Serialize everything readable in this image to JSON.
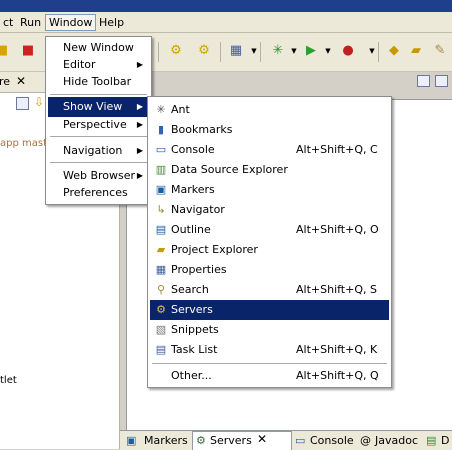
{
  "menubar": {
    "items": [
      "ct",
      "Run",
      "Window",
      "Help"
    ]
  },
  "window_menu": {
    "items": [
      {
        "label": "New Window",
        "submenu": false
      },
      {
        "label": "Editor",
        "submenu": true
      },
      {
        "label": "Hide Toolbar",
        "submenu": false
      },
      {
        "label": "Show View",
        "submenu": true,
        "selected": true
      },
      {
        "label": "Perspective",
        "submenu": true
      },
      {
        "label": "Navigation",
        "submenu": true
      },
      {
        "label": "Web Browser",
        "submenu": true
      },
      {
        "label": "Preferences",
        "submenu": false
      }
    ]
  },
  "show_view_menu": {
    "items": [
      {
        "label": "Ant",
        "shortcut": "",
        "icon": "ant-icon"
      },
      {
        "label": "Bookmarks",
        "shortcut": "",
        "icon": "bookmarks-icon"
      },
      {
        "label": "Console",
        "shortcut": "Alt+Shift+Q, C",
        "icon": "console-icon"
      },
      {
        "label": "Data Source Explorer",
        "shortcut": "",
        "icon": "data-source-icon"
      },
      {
        "label": "Markers",
        "shortcut": "",
        "icon": "markers-icon"
      },
      {
        "label": "Navigator",
        "shortcut": "",
        "icon": "navigator-icon"
      },
      {
        "label": "Outline",
        "shortcut": "Alt+Shift+Q, O",
        "icon": "outline-icon"
      },
      {
        "label": "Project Explorer",
        "shortcut": "",
        "icon": "project-explorer-icon"
      },
      {
        "label": "Properties",
        "shortcut": "",
        "icon": "properties-icon"
      },
      {
        "label": "Search",
        "shortcut": "Alt+Shift+Q, S",
        "icon": "search-icon"
      },
      {
        "label": "Servers",
        "shortcut": "",
        "icon": "servers-icon",
        "selected": true
      },
      {
        "label": "Snippets",
        "shortcut": "",
        "icon": "snippets-icon"
      },
      {
        "label": "Task List",
        "shortcut": "Alt+Shift+Q, K",
        "icon": "task-list-icon"
      }
    ],
    "other": {
      "label": "Other...",
      "shortcut": "Alt+Shift+Q, Q"
    }
  },
  "left_view": {
    "tab_label": "re",
    "text1": "app mast",
    "text2": "tlet"
  },
  "bottom_tabs": [
    "Markers",
    "Servers",
    "Console",
    "Javadoc",
    "D"
  ],
  "colors": {
    "selection": "#0a246a",
    "titlebar": "#1f3e8c",
    "menubar": "#ece9d8"
  }
}
